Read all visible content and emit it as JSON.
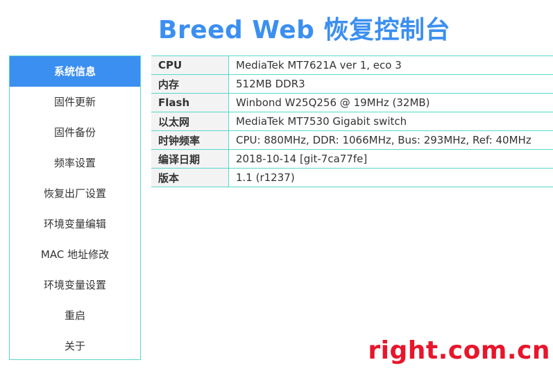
{
  "header": {
    "title": "Breed Web 恢复控制台"
  },
  "sidebar": {
    "items": [
      {
        "label": "系统信息",
        "active": true
      },
      {
        "label": "固件更新"
      },
      {
        "label": "固件备份"
      },
      {
        "label": "频率设置"
      },
      {
        "label": "恢复出厂设置"
      },
      {
        "label": "环境变量编辑"
      },
      {
        "label": "MAC 地址修改"
      },
      {
        "label": "环境变量设置"
      },
      {
        "label": "重启"
      },
      {
        "label": "关于"
      }
    ]
  },
  "info": {
    "rows": [
      {
        "key": "CPU",
        "value": "MediaTek MT7621A ver 1, eco 3"
      },
      {
        "key": "内存",
        "value": "512MB DDR3"
      },
      {
        "key": "Flash",
        "value": "Winbond W25Q256 @ 19MHz (32MB)"
      },
      {
        "key": "以太网",
        "value": "MediaTek MT7530 Gigabit switch"
      },
      {
        "key": "时钟频率",
        "value": "CPU: 880MHz, DDR: 1066MHz, Bus: 293MHz, Ref: 40MHz"
      },
      {
        "key": "编译日期",
        "value": "2018-10-14 [git-7ca77fe]"
      },
      {
        "key": "版本",
        "value": "1.1 (r1237)"
      }
    ]
  },
  "watermark": {
    "text": "right.com.cn"
  },
  "colors": {
    "accent": "#3b8ff0",
    "border": "#57d7c9",
    "watermark": "#e8152b"
  }
}
